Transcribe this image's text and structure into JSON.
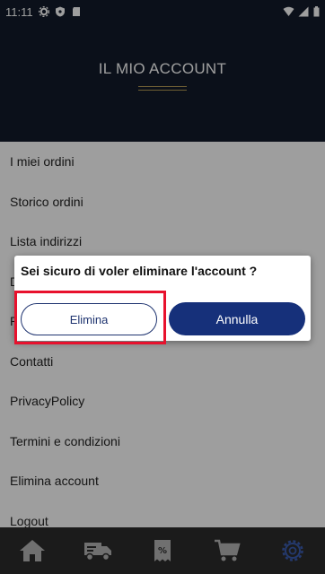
{
  "status_bar": {
    "time": "11:11"
  },
  "header": {
    "title": "IL MIO ACCOUNT"
  },
  "menu": {
    "items": [
      {
        "label": "I miei ordini"
      },
      {
        "label": "Storico ordini"
      },
      {
        "label": "Lista indirizzi"
      },
      {
        "label": "D"
      },
      {
        "label": "P"
      },
      {
        "label": "Contatti"
      },
      {
        "label": "PrivacyPolicy"
      },
      {
        "label": "Termini e condizioni"
      },
      {
        "label": "Elimina account"
      },
      {
        "label": "Logout"
      }
    ]
  },
  "dialog": {
    "title": "Sei sicuro di voler eliminare l'account ?",
    "delete_label": "Elimina",
    "cancel_label": "Annulla"
  },
  "bottom_nav": {
    "items": [
      {
        "icon": "home-icon"
      },
      {
        "icon": "delivery-truck-icon"
      },
      {
        "icon": "discount-tag-icon"
      },
      {
        "icon": "shopping-cart-icon"
      },
      {
        "icon": "settings-gear-icon"
      }
    ]
  },
  "colors": {
    "header_bg": "#121b2a",
    "accent_gold": "#b49a55",
    "primary_blue": "#16307a",
    "highlight_red": "#e8112d",
    "nav_bg": "#2c2c2c",
    "active_icon": "#3b5cb0"
  }
}
